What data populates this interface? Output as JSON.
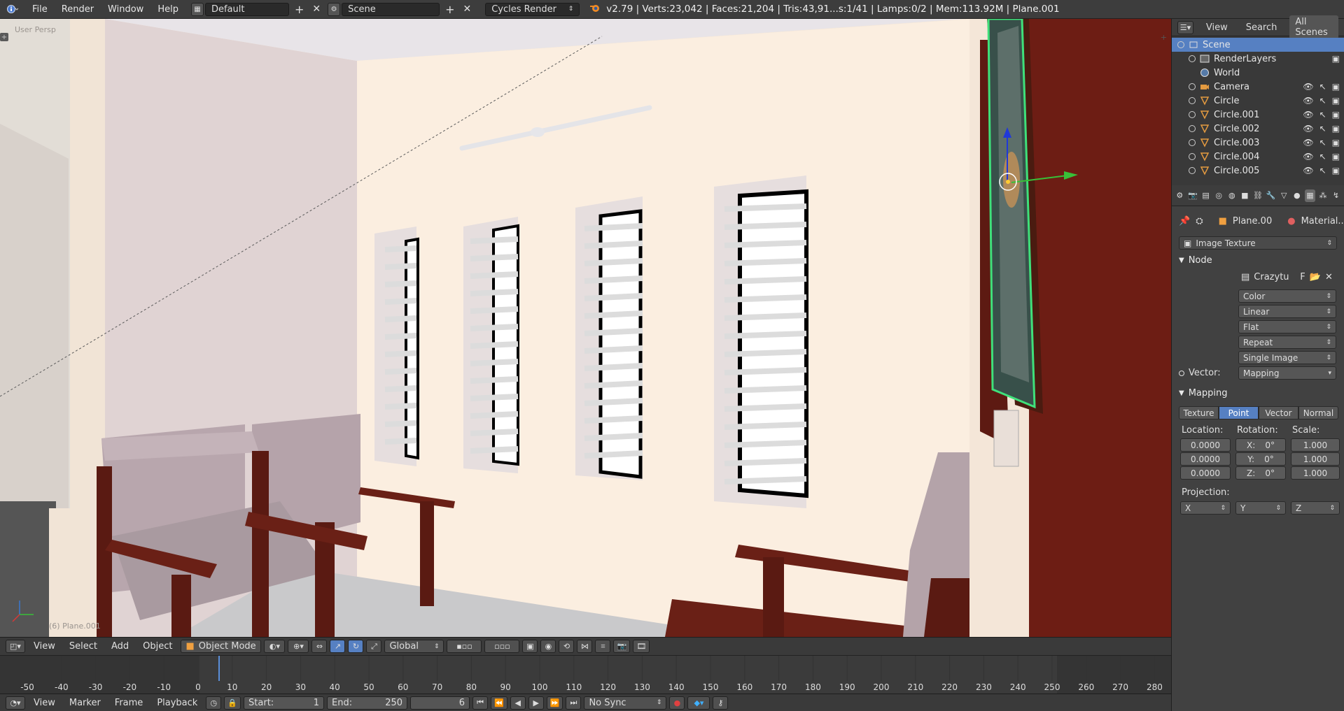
{
  "topbar": {
    "info_icon": "info-icon",
    "menus": [
      "File",
      "Render",
      "Window",
      "Help"
    ],
    "layout": "Default",
    "scene": "Scene",
    "engine": "Cycles Render",
    "stats": "v2.79 | Verts:23,042 | Faces:21,204 | Tris:43,91...s:1/41 | Lamps:0/2 | Mem:113.92M | Plane.001"
  },
  "viewport": {
    "view_label": "User Persp",
    "object_label": "(6) Plane.001"
  },
  "viewport_header": {
    "menus": [
      "View",
      "Select",
      "Add",
      "Object"
    ],
    "mode": "Object Mode",
    "orientation": "Global"
  },
  "timeline": {
    "ticks": [
      "-50",
      "-40",
      "-30",
      "-20",
      "-10",
      "0",
      "10",
      "20",
      "30",
      "40",
      "50",
      "60",
      "70",
      "80",
      "90",
      "100",
      "110",
      "120",
      "130",
      "140",
      "150",
      "160",
      "170",
      "180",
      "190",
      "200",
      "210",
      "220",
      "230",
      "240",
      "250",
      "260",
      "270",
      "280"
    ],
    "current_frame": 6
  },
  "timeline_header": {
    "menus": [
      "View",
      "Marker",
      "Frame",
      "Playback"
    ],
    "start_label": "Start:",
    "start_value": "1",
    "end_label": "End:",
    "end_value": "250",
    "frame_value": "6",
    "sync": "No Sync"
  },
  "outliner": {
    "tabs": [
      "View",
      "Search",
      "All Scenes"
    ],
    "rows": [
      {
        "name": "Scene",
        "level": 0,
        "icon": "scene-icon",
        "selected": true
      },
      {
        "name": "RenderLayers",
        "level": 1,
        "icon": "renderlayers-icon"
      },
      {
        "name": "World",
        "level": 1,
        "icon": "world-icon"
      },
      {
        "name": "Camera",
        "level": 1,
        "icon": "camera-icon"
      },
      {
        "name": "Circle",
        "level": 1,
        "icon": "mesh-icon"
      },
      {
        "name": "Circle.001",
        "level": 1,
        "icon": "mesh-icon"
      },
      {
        "name": "Circle.002",
        "level": 1,
        "icon": "mesh-icon"
      },
      {
        "name": "Circle.003",
        "level": 1,
        "icon": "mesh-icon"
      },
      {
        "name": "Circle.004",
        "level": 1,
        "icon": "mesh-icon"
      },
      {
        "name": "Circle.005",
        "level": 1,
        "icon": "mesh-icon"
      }
    ]
  },
  "properties": {
    "breadcrumb_object": "Plane.00",
    "breadcrumb_material": "Material....",
    "texture_type": "Image Texture",
    "node_panel": "Node",
    "image_name": "Crazytu",
    "image_flag": "F",
    "node_options": [
      "Color",
      "Linear",
      "Flat",
      "Repeat",
      "Single Image"
    ],
    "vector_label": "Vector:",
    "vector_value": "Mapping",
    "mapping_panel": "Mapping",
    "mapping_tabs": [
      "Texture",
      "Point",
      "Vector",
      "Normal"
    ],
    "mapping_active": "Point",
    "location_label": "Location:",
    "rotation_label": "Rotation:",
    "scale_label": "Scale:",
    "location": [
      "0.0000",
      "0.0000",
      "0.0000"
    ],
    "rotation": [
      {
        "axis": "X:",
        "value": "0°"
      },
      {
        "axis": "Y:",
        "value": "0°"
      },
      {
        "axis": "Z:",
        "value": "0°"
      }
    ],
    "scale": [
      "1.000",
      "1.000",
      "1.000"
    ],
    "projection_label": "Projection:",
    "projection": [
      "X",
      "Y",
      "Z"
    ]
  }
}
